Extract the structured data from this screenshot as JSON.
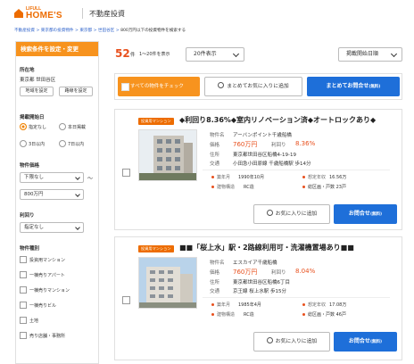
{
  "header": {
    "logo_top": "LIFULL",
    "logo_main": "HOME'S",
    "title": "不動産投資"
  },
  "breadcrumbs": [
    "不動産投資",
    "東京都の投資物件",
    "東京都",
    "世田谷区"
  ],
  "breadcrumb_current": "800万円以下の投資物件を検索する",
  "sidebar": {
    "heading": "検索条件を設定・変更",
    "location_label": "所在地",
    "location_value": "東京都 世田谷区",
    "btn_area": "地域を設定",
    "btn_line": "路線を設定",
    "posted_label": "掲載開始日",
    "posted_options": [
      "指定なし",
      "本日掲載",
      "3日以内",
      "7日以内"
    ],
    "price_label": "物件価格",
    "price_min": "下限なし",
    "price_tilde": "〜",
    "price_max": "800万円",
    "yield_label": "利回り",
    "yield_value": "指定なし",
    "type_label": "物件種別",
    "types": [
      "投資用マンション",
      "一棟売りアパート",
      "一棟売りマンション",
      "一棟売りビル",
      "土地",
      "売り店舗・事務所"
    ]
  },
  "results": {
    "count": "52",
    "count_unit": "件",
    "range": "1〜20件を表示",
    "per_page": "20件表示",
    "sort": "掲載開始日順"
  },
  "actions": {
    "check_all": "すべての物件をチェック",
    "fav_all": "まとめてお気に入りに追加",
    "inquire_all": "まとめてお問合せ",
    "inquire_all_sub": "(無料)"
  },
  "labels": {
    "name": "物件名",
    "price": "価格",
    "yield": "利回り",
    "address": "住所",
    "access": "交通",
    "built": "築年月",
    "expected": "想定年収",
    "structure": "建物構造",
    "units": "総区画・戸数",
    "fav": "お気に入りに追加",
    "inquire": "お問合せ",
    "inquire_sub": "(無料)"
  },
  "listings": [
    {
      "tag": "投資用マンション",
      "title": "◆利回り8.36%◆室内リノベーション済◆オートロックあり◆",
      "name": "アーバンポイント千歳船橋",
      "price": "760万円",
      "yield": "8.36%",
      "address": "東京都世田谷区船橋4-19-19",
      "access": "小田急小田原線 千歳船橋駅 歩14分",
      "built": "1990年10月",
      "income": "16.56万",
      "structure": "RC造",
      "units": "総区画・戸数 23戸"
    },
    {
      "tag": "投資用マンション",
      "title": "■■「桜上水」駅・2路線利用可・洗濯機置場あり■■",
      "name": "エスカイア千歳船橋",
      "price": "760万円",
      "yield": "8.04%",
      "address": "東京都世田谷区船橋6丁目",
      "access": "京王線 桜上水駅 歩15分",
      "built": "1985年4月",
      "income": "17.08万",
      "structure": "RC造",
      "units": "総区画・戸数 46戸"
    }
  ],
  "colors": {
    "brand": "#ed6c00",
    "accent": "#e8501d",
    "blue": "#1e6fd9",
    "orange_btn": "#f7931e"
  }
}
